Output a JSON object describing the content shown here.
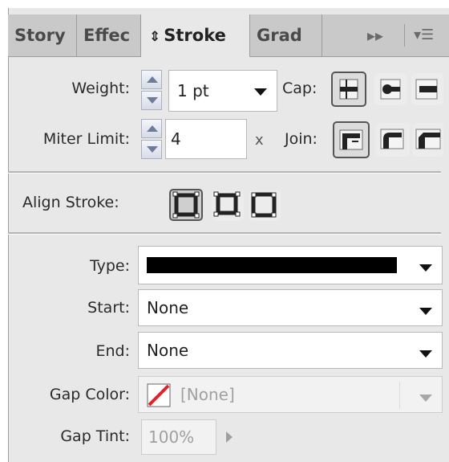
{
  "tabs": [
    {
      "label": "Story"
    },
    {
      "label": "Effec"
    },
    {
      "label": "Stroke",
      "active": true
    },
    {
      "label": "Grad"
    }
  ],
  "tab_controls": {
    "expand_icon": "double-chevron-right-icon",
    "menu_icon": "panel-menu-icon"
  },
  "weight": {
    "label": "Weight:",
    "value": "1 pt"
  },
  "cap": {
    "label": "Cap:",
    "options": [
      "butt-cap-icon",
      "round-cap-icon",
      "projecting-cap-icon"
    ],
    "selected": 0
  },
  "miter": {
    "label": "Miter Limit:",
    "value": "4",
    "unit": "x"
  },
  "join": {
    "label": "Join:",
    "options": [
      "miter-join-icon",
      "round-join-icon",
      "bevel-join-icon"
    ],
    "selected": 0
  },
  "align": {
    "label": "Align Stroke:",
    "options": [
      "align-center-icon",
      "align-inside-icon",
      "align-outside-icon"
    ],
    "selected": 0
  },
  "type": {
    "label": "Type:",
    "value_swatch": "#000000"
  },
  "start": {
    "label": "Start:",
    "value": "None"
  },
  "end": {
    "label": "End:",
    "value": "None"
  },
  "gap_color": {
    "label": "Gap Color:",
    "value": "[None]",
    "swatch": "none-swatch-icon"
  },
  "gap_tint": {
    "label": "Gap Tint:",
    "value": "100%"
  },
  "colors": {
    "panel_bg": "#e8e8e8",
    "tab_bg": "#c9c9c9",
    "none_red": "#e0202a"
  }
}
